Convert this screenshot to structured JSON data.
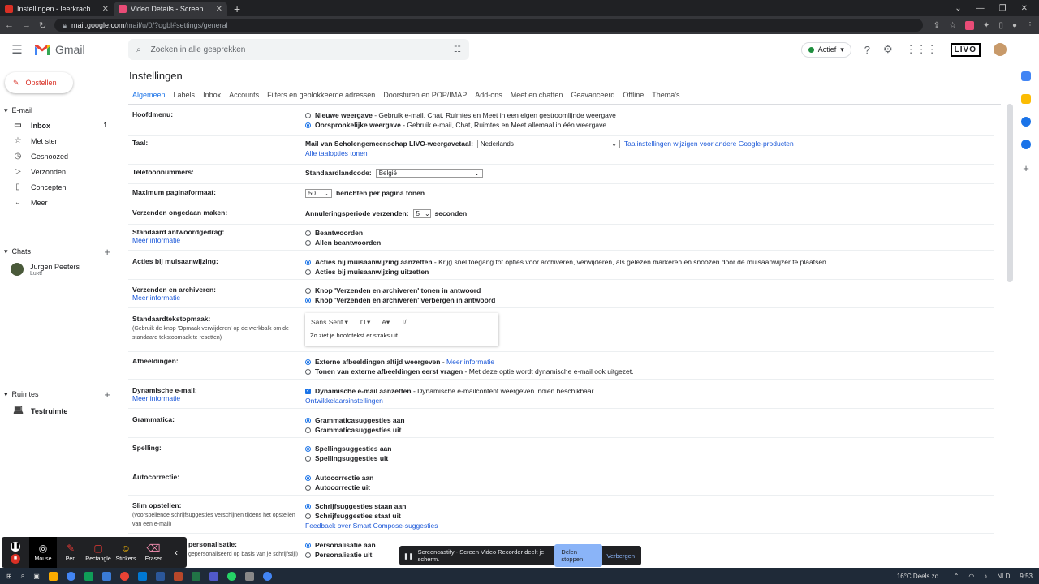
{
  "browser": {
    "tabs": [
      {
        "title": "Instellingen - leerkracht@livone",
        "color": "#d93025",
        "active": false
      },
      {
        "title": "Video Details - Screencastify",
        "color": "#e94c77",
        "active": true
      }
    ],
    "url_domain": "mail.google.com",
    "url_path": "/mail/u/0/?ogbl#settings/general"
  },
  "header": {
    "app_name": "Gmail",
    "search_placeholder": "Zoeken in alle gesprekken",
    "status": "Actief",
    "org_logo": "LIVO"
  },
  "sidebar": {
    "compose": "Opstellen",
    "email_section": "E-mail",
    "items": [
      {
        "label": "Inbox",
        "icon": "inbox-icon",
        "glyph": "▭",
        "count": "1",
        "bold": true
      },
      {
        "label": "Met ster",
        "icon": "star-icon",
        "glyph": "☆",
        "count": ""
      },
      {
        "label": "Gesnoozed",
        "icon": "clock-icon",
        "glyph": "◷",
        "count": ""
      },
      {
        "label": "Verzonden",
        "icon": "send-icon",
        "glyph": "▷",
        "count": ""
      },
      {
        "label": "Concepten",
        "icon": "draft-icon",
        "glyph": "▯",
        "count": ""
      },
      {
        "label": "Meer",
        "icon": "chevron-down-icon",
        "glyph": "⌄",
        "count": ""
      }
    ],
    "chats_section": "Chats",
    "chat_user": {
      "name": "Jurgen Peeters",
      "status": "Lukt!"
    },
    "spaces_section": "Ruimtes",
    "space": "Testruimte"
  },
  "main": {
    "title": "Instellingen",
    "tabs": [
      "Algemeen",
      "Labels",
      "Inbox",
      "Accounts",
      "Filters en geblokkeerde adressen",
      "Doorsturen en POP/IMAP",
      "Add-ons",
      "Meet en chatten",
      "Geavanceerd",
      "Offline",
      "Thema's"
    ]
  },
  "settings": {
    "hoofdmenu": {
      "label": "Hoofdmenu:",
      "opt1_b": "Nieuwe weergave",
      "opt1_t": " - Gebruik e-mail, Chat, Ruimtes en Meet in een eigen gestroomlijnde weergave",
      "opt2_b": "Oorspronkelijke weergave",
      "opt2_t": " - Gebruik e-mail, Chat, Ruimtes en Meet allemaal in één weergave"
    },
    "taal": {
      "label": "Taal:",
      "text": "Mail van Scholengemeenschap LIVO-weergavetaal:",
      "value": "Nederlands",
      "link": "Taalinstellingen wijzigen voor andere Google-producten",
      "link2": "Alle taalopties tonen"
    },
    "telefoon": {
      "label": "Telefoonnummers:",
      "text": "Standaardlandcode:",
      "value": "België"
    },
    "pagina": {
      "label": "Maximum paginaformaat:",
      "value": "50",
      "text": "berichten per pagina tonen"
    },
    "ongedaan": {
      "label": "Verzenden ongedaan maken:",
      "text": "Annuleringsperiode verzenden:",
      "value": "5",
      "unit": "seconden"
    },
    "antwoord": {
      "label": "Standaard antwoordgedrag:",
      "link": "Meer informatie",
      "opt1": "Beantwoorden",
      "opt2": "Allen beantwoorden"
    },
    "muis": {
      "label": "Acties bij muisaanwijzing:",
      "opt1_b": "Acties bij muisaanwijzing aanzetten",
      "opt1_t": " - Krijg snel toegang tot opties voor archiveren, verwijderen, als gelezen markeren en snoozen door de muisaanwijzer te plaatsen.",
      "opt2": "Acties bij muisaanwijzing uitzetten"
    },
    "archiveren": {
      "label": "Verzenden en archiveren:",
      "link": "Meer informatie",
      "opt1": "Knop 'Verzenden en archiveren' tonen in antwoord",
      "opt2": "Knop 'Verzenden en archiveren' verbergen in antwoord"
    },
    "tekstopmaak": {
      "label": "Standaardtekstopmaak:",
      "sub": "(Gebruik de knop 'Opmaak verwijderen' op de werkbalk om de standaard tekstopmaak te resetten)",
      "font": "Sans Serif",
      "preview": "Zo ziet je hoofdtekst er straks uit"
    },
    "afbeeldingen": {
      "label": "Afbeeldingen:",
      "opt1_b": "Externe afbeeldingen altijd weergeven",
      "opt1_sep": " - ",
      "opt1_link": "Meer informatie",
      "opt2_b": "Tonen van externe afbeeldingen eerst vragen",
      "opt2_t": " - Met deze optie wordt dynamische e-mail ook uitgezet."
    },
    "dynamisch": {
      "label": "Dynamische e-mail:",
      "link": "Meer informatie",
      "opt1_b": "Dynamische e-mail aanzetten",
      "opt1_t": " - Dynamische e-mailcontent weergeven indien beschikbaar.",
      "link2": "Ontwikkelaarsinstellingen"
    },
    "grammatica": {
      "label": "Grammatica:",
      "opt1": "Grammaticasuggesties aan",
      "opt2": "Grammaticasuggesties uit"
    },
    "spelling": {
      "label": "Spelling:",
      "opt1": "Spellingsuggesties aan",
      "opt2": "Spellingsuggesties uit"
    },
    "autocorrectie": {
      "label": "Autocorrectie:",
      "opt1": "Autocorrectie aan",
      "opt2": "Autocorrectie uit"
    },
    "slim": {
      "label": "Slim opstellen:",
      "sub": "(voorspellende schrijfsuggesties verschijnen tijdens het opstellen van een e-mail)",
      "opt1": "Schrijfsuggesties staan aan",
      "opt2": "Schrijfsuggesties staat uit",
      "link": "Feedback over Smart Compose-suggesties"
    },
    "personalisatie": {
      "label": "personalisatie:",
      "sub": "gepersonaliseerd op basis van je schrijfstijl)",
      "opt1": "Personalisatie aan",
      "opt2": "Personalisatie uit"
    }
  },
  "screencastify": {
    "tools": [
      "Mouse",
      "Pen",
      "Rectangle",
      "Stickers",
      "Eraser"
    ],
    "share_text": "Screencastify - Screen Video Recorder deelt je scherm.",
    "stop": "Delen stoppen",
    "hide": "Verbergen"
  },
  "taskbar": {
    "weather": "16°C  Deels zo...",
    "lang": "NLD",
    "time": "9:53"
  }
}
